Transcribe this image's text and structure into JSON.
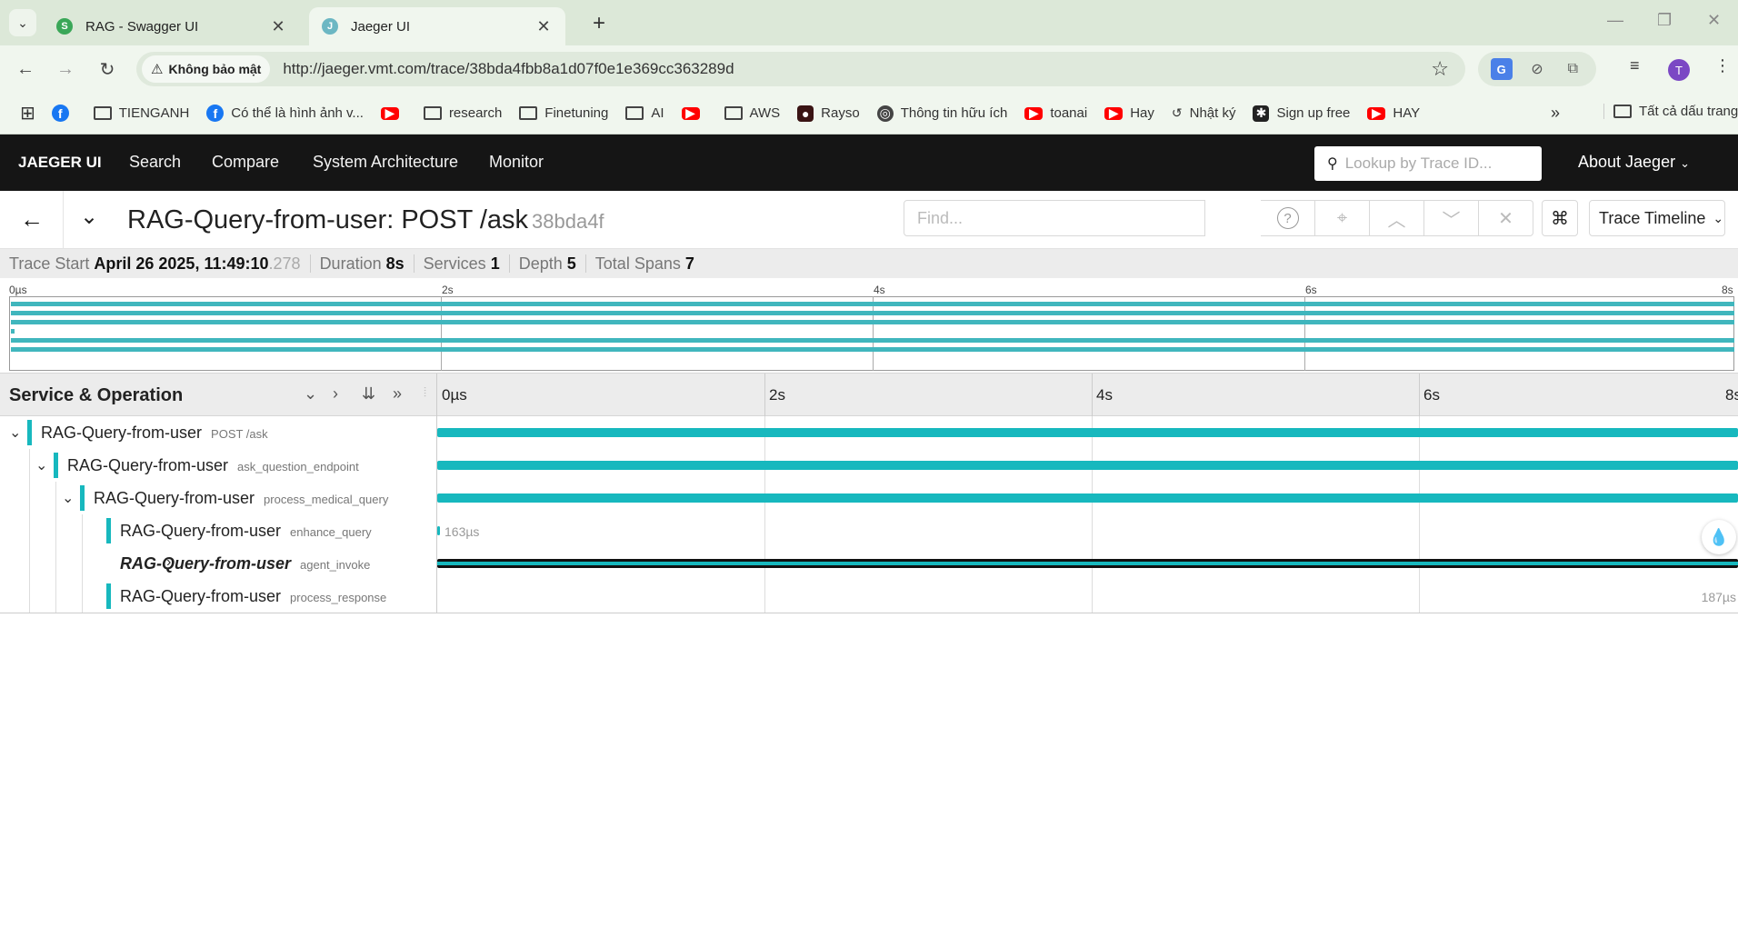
{
  "browser": {
    "tabs": [
      {
        "title": "RAG - Swagger UI",
        "icon": "swagger-icon",
        "active": false
      },
      {
        "title": "Jaeger UI",
        "icon": "jaeger-icon",
        "active": true
      }
    ],
    "security_label": "Không bảo mật",
    "url": "http://jaeger.vmt.com/trace/38bda4fbb8a1d07f0e1e369cc363289d",
    "avatar_letter": "T",
    "bookmarks": [
      {
        "label": "",
        "icon": "facebook-icon"
      },
      {
        "label": "TIENGANH",
        "icon": "folder-icon"
      },
      {
        "label": "Có thể là hình ảnh v...",
        "icon": "facebook-icon"
      },
      {
        "label": "",
        "icon": "youtube-icon"
      },
      {
        "label": "research",
        "icon": "folder-icon"
      },
      {
        "label": "Finetuning",
        "icon": "folder-icon"
      },
      {
        "label": "AI",
        "icon": "folder-icon"
      },
      {
        "label": "",
        "icon": "youtube-icon"
      },
      {
        "label": "AWS",
        "icon": "folder-icon"
      },
      {
        "label": "Rayso",
        "icon": "rayso-icon"
      },
      {
        "label": "Thông tin hữu ích",
        "icon": "globe-icon"
      },
      {
        "label": "toanai",
        "icon": "youtube-icon"
      },
      {
        "label": "Hay",
        "icon": "youtube-icon"
      },
      {
        "label": "Nhật ký",
        "icon": "history-icon"
      },
      {
        "label": "Sign up free",
        "icon": "app-icon"
      },
      {
        "label": "HAY",
        "icon": "youtube-icon"
      }
    ],
    "all_bookmarks": "Tất cả dấu trang"
  },
  "jaeger": {
    "brand": "JAEGER UI",
    "nav": [
      "Search",
      "Compare",
      "System Architecture",
      "Monitor"
    ],
    "lookup_placeholder": "Lookup by Trace ID...",
    "about": "About Jaeger"
  },
  "trace": {
    "service": "RAG-Query-from-user",
    "title_sep": ": ",
    "operation": "POST /ask",
    "short_id": "38bda4f",
    "find_placeholder": "Find...",
    "view_mode": "Trace Timeline",
    "meta": {
      "start_label": "Trace Start",
      "start_value": "April 26 2025, 11:49:10",
      "start_ms": ".278",
      "duration_label": "Duration",
      "duration_value": "8s",
      "services_label": "Services",
      "services_value": "1",
      "depth_label": "Depth",
      "depth_value": "5",
      "spans_label": "Total Spans",
      "spans_value": "7"
    },
    "minimap_ticks": [
      "0µs",
      "2s",
      "4s",
      "6s",
      "8s"
    ],
    "header_title": "Service & Operation",
    "timeline_ticks": [
      "0µs",
      "2s",
      "4s",
      "6s",
      "8s"
    ],
    "spans": [
      {
        "service": "RAG-Query-from-user",
        "operation": "POST /ask",
        "depth": 0,
        "toggle": "open",
        "start": 0.0,
        "duration": 1.0,
        "label": ""
      },
      {
        "service": "RAG-Query-from-user",
        "operation": "ask_question_endpoint",
        "depth": 1,
        "toggle": "open",
        "start": 0.0,
        "duration": 1.0,
        "label": ""
      },
      {
        "service": "RAG-Query-from-user",
        "operation": "process_medical_query",
        "depth": 2,
        "toggle": "open",
        "start": 0.0,
        "duration": 1.0,
        "label": ""
      },
      {
        "service": "RAG-Query-from-user",
        "operation": "enhance_query",
        "depth": 3,
        "toggle": "none",
        "start": 0.0,
        "duration": 0.0015,
        "label": "163µs"
      },
      {
        "service": "RAG-Query-from-user",
        "operation": "agent_invoke",
        "depth": 3,
        "toggle": "closed",
        "start": 0.0,
        "duration": 1.0,
        "label": "",
        "selected": true
      },
      {
        "service": "RAG-Query-from-user",
        "operation": "process_response",
        "depth": 3,
        "toggle": "none",
        "start": 1.0,
        "duration": 0.0,
        "label": "187µs"
      }
    ],
    "colors": {
      "service": "#17b8be",
      "minimap": "#40b6bd"
    }
  }
}
